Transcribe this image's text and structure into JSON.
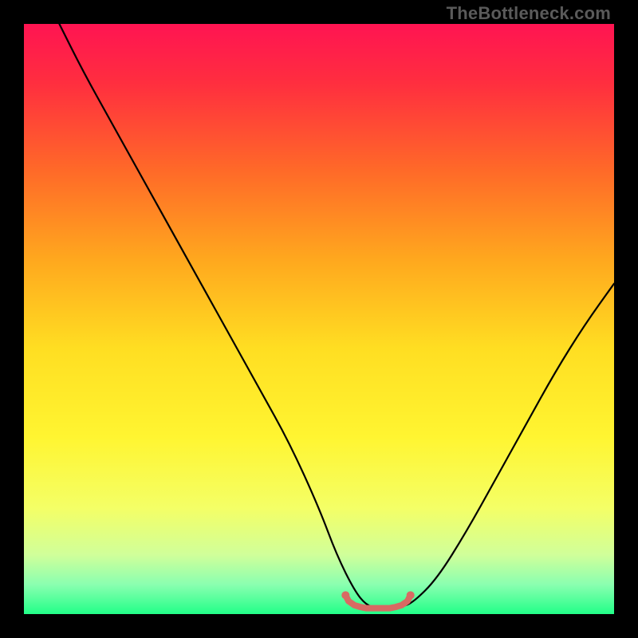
{
  "watermark": "TheBottleneck.com",
  "chart_data": {
    "type": "line",
    "title": "",
    "xlabel": "",
    "ylabel": "",
    "xlim": [
      0,
      100
    ],
    "ylim": [
      0,
      100
    ],
    "grid": false,
    "legend": false,
    "gradient_stops": [
      {
        "pct": 0,
        "color": "#ff1452"
      },
      {
        "pct": 10,
        "color": "#ff2e3f"
      },
      {
        "pct": 25,
        "color": "#ff6a28"
      },
      {
        "pct": 40,
        "color": "#ffa81e"
      },
      {
        "pct": 55,
        "color": "#ffde22"
      },
      {
        "pct": 70,
        "color": "#fff531"
      },
      {
        "pct": 82,
        "color": "#f4ff66"
      },
      {
        "pct": 90,
        "color": "#d0ff9a"
      },
      {
        "pct": 95,
        "color": "#8affb0"
      },
      {
        "pct": 100,
        "color": "#22ff88"
      }
    ],
    "series": [
      {
        "name": "curve",
        "color": "#000000",
        "stroke_width": 2.2,
        "x": [
          6,
          10,
          15,
          20,
          25,
          30,
          35,
          40,
          45,
          50,
          53,
          56,
          58,
          60,
          62,
          64,
          66,
          70,
          75,
          80,
          85,
          90,
          95,
          100
        ],
        "y": [
          100,
          92,
          83,
          74,
          65,
          56,
          47,
          38,
          29,
          18,
          10,
          4,
          1.5,
          1.0,
          1.0,
          1.2,
          2.0,
          6,
          14,
          23,
          32,
          41,
          49,
          56
        ]
      },
      {
        "name": "optimum-marker",
        "color": "#d86a63",
        "stroke_width": 8,
        "x": [
          54.5,
          55,
          56,
          57,
          58,
          59,
          60,
          61,
          62,
          63,
          64,
          65,
          65.5
        ],
        "y": [
          3.2,
          2.2,
          1.5,
          1.2,
          1.0,
          1.0,
          1.0,
          1.0,
          1.0,
          1.2,
          1.5,
          2.2,
          3.2
        ]
      }
    ]
  }
}
